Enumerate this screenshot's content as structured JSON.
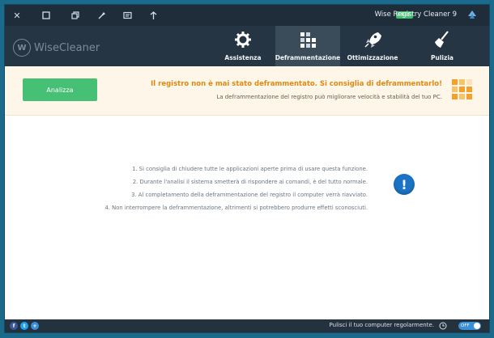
{
  "titlebar": {
    "title": "Wise Registry Cleaner 9",
    "badge": "FREE",
    "controls": [
      "close-icon",
      "maximize-icon",
      "restore-icon",
      "skin-icon",
      "feedback-icon",
      "pin-icon"
    ]
  },
  "navbar": {
    "brand_letter": "W",
    "brand_name": "WiseCleaner",
    "tabs": [
      {
        "label": "Pulizia",
        "icon": "broom-icon"
      },
      {
        "label": "Ottimizzazione",
        "icon": "rocket-icon"
      },
      {
        "label": "Deframmentazione",
        "icon": "blocks-icon",
        "active": true
      },
      {
        "label": "Assistenza",
        "icon": "tools-icon"
      }
    ]
  },
  "banner": {
    "button_label": "Analizza",
    "title": "Il registro non è mai stato deframmentato. Si consiglia di deframmentarlo!",
    "subtitle": "La deframmentazione del registro può migliorare velocità e stabilità del tuo PC."
  },
  "tips": [
    "1. Si consiglia di chiudere tutte le applicazioni aperte prima di usare questa funzione.",
    "2. Durante l'analisi il sistema smetterà di rispondere ai comandi, è del tutto normale.",
    "3. Al completamento della deframmentazione del registro il computer verrà riavviato.",
    "4. Non interrompere la deframmentazione, altrimenti si potrebbero produrre effetti sconosciuti."
  ],
  "footer": {
    "schedule_text": "Pulisci il tuo computer regolarmente.",
    "toggle_label": "OFF"
  },
  "colors": {
    "accent_green": "#46c075",
    "warning_orange": "#e08a12",
    "info_blue": "#1a73c4",
    "nav_bg": "#253543"
  }
}
